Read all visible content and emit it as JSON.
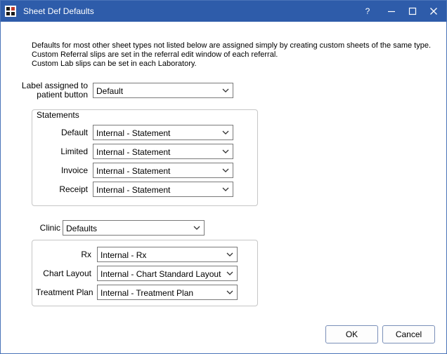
{
  "window": {
    "title": "Sheet Def Defaults",
    "help_label": "?"
  },
  "info": {
    "line1": "Defaults for most other sheet types not listed below are assigned simply by creating custom sheets of the same type.",
    "line2": "Custom Referral slips are set in the referral edit window of each referral.",
    "line3": "Custom Lab slips can be set in each Laboratory."
  },
  "label_assigned": {
    "label_line1": "Label assigned to",
    "label_line2": "patient button",
    "value": "Default"
  },
  "statements": {
    "title": "Statements",
    "rows": [
      {
        "label": "Default",
        "value": "Internal - Statement"
      },
      {
        "label": "Limited",
        "value": "Internal - Statement"
      },
      {
        "label": "Invoice",
        "value": "Internal - Statement"
      },
      {
        "label": "Receipt",
        "value": "Internal - Statement"
      }
    ]
  },
  "clinic": {
    "label": "Clinic",
    "value": "Defaults"
  },
  "clinic_group": {
    "rows": [
      {
        "label": "Rx",
        "value": "Internal - Rx"
      },
      {
        "label": "Chart Layout",
        "value": "Internal - Chart Standard Layout"
      },
      {
        "label": "Treatment Plan",
        "value": "Internal - Treatment Plan"
      }
    ]
  },
  "buttons": {
    "ok": "OK",
    "cancel": "Cancel"
  }
}
